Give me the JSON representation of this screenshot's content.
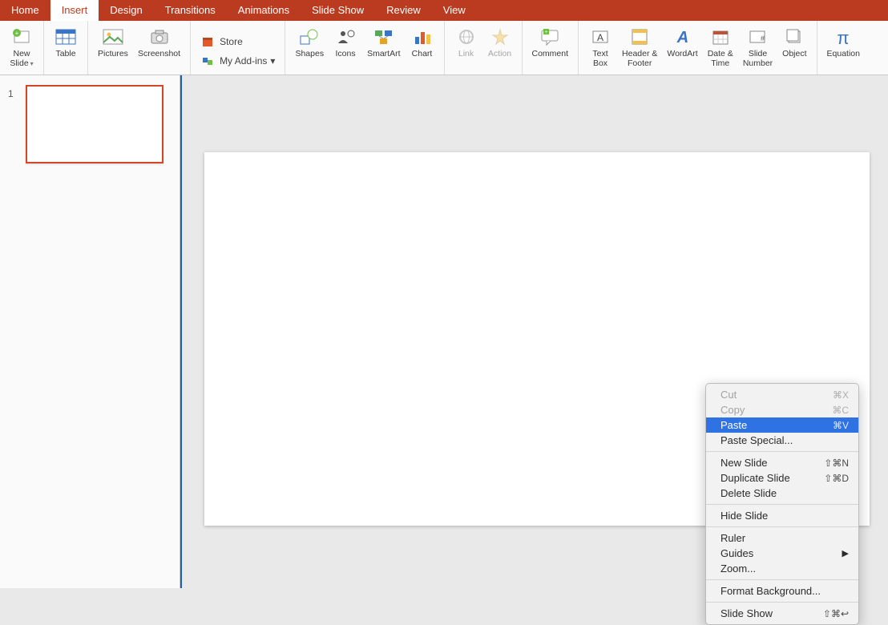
{
  "tabs": [
    "Home",
    "Insert",
    "Design",
    "Transitions",
    "Animations",
    "Slide Show",
    "Review",
    "View"
  ],
  "active_tab": "Insert",
  "ribbon": {
    "new_slide": "New\nSlide",
    "table": "Table",
    "pictures": "Pictures",
    "screenshot": "Screenshot",
    "store": "Store",
    "my_addins": "My Add-ins",
    "shapes": "Shapes",
    "icons": "Icons",
    "smartart": "SmartArt",
    "chart": "Chart",
    "link": "Link",
    "action": "Action",
    "comment": "Comment",
    "text_box": "Text\nBox",
    "header_footer": "Header &\nFooter",
    "wordart": "WordArt",
    "date_time": "Date &\nTime",
    "slide_number": "Slide\nNumber",
    "object": "Object",
    "equation": "Equation"
  },
  "sidebar": {
    "slide_number": "1"
  },
  "context_menu": {
    "cut": {
      "label": "Cut",
      "shortcut": "⌘X"
    },
    "copy": {
      "label": "Copy",
      "shortcut": "⌘C"
    },
    "paste": {
      "label": "Paste",
      "shortcut": "⌘V"
    },
    "paste_special": {
      "label": "Paste Special..."
    },
    "new_slide": {
      "label": "New Slide",
      "shortcut": "⇧⌘N"
    },
    "duplicate_slide": {
      "label": "Duplicate Slide",
      "shortcut": "⇧⌘D"
    },
    "delete_slide": {
      "label": "Delete Slide"
    },
    "hide_slide": {
      "label": "Hide Slide"
    },
    "ruler": {
      "label": "Ruler"
    },
    "guides": {
      "label": "Guides"
    },
    "zoom": {
      "label": "Zoom..."
    },
    "format_background": {
      "label": "Format Background..."
    },
    "slide_show": {
      "label": "Slide Show",
      "shortcut": "⇧⌘↩"
    }
  }
}
